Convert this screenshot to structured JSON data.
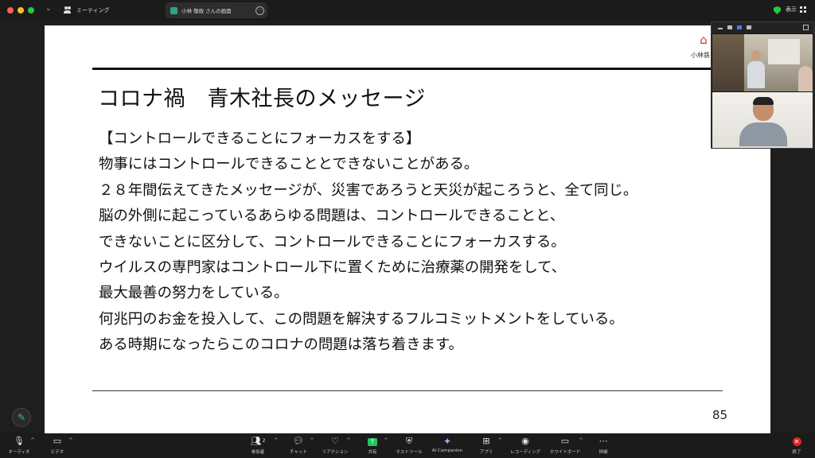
{
  "window": {
    "meeting_tab_label": "ミーティング",
    "screen_tab_label": "小林 敬政 さんの画面",
    "view_label": "表示"
  },
  "slide": {
    "logo_text": "小林鉄",
    "title": "コロナ禍　青木社長のメッセージ",
    "lines": [
      "【コントロールできることにフォーカスをする】",
      "物事にはコントロールできることとできないことがある。",
      "２８年間伝えてきたメッセージが、災害であろうと天災が起ころうと、全て同じ。",
      "脳の外側に起こっているあらゆる問題は、コントロールできることと、",
      "できないことに区分して、コントロールできることにフォーカスする。",
      "ウイルスの専門家はコントロール下に置くために治療薬の開発をして、",
      "最大最善の努力をしている。",
      "何兆円のお金を投入して、この問題を解決するフルコミットメントをしている。",
      "ある時期になったらこのコロナの問題は落ち着きます。"
    ],
    "page_number": "85"
  },
  "toolbar": {
    "audio": "オーディオ",
    "video": "ビデオ",
    "participants": "参加者",
    "participants_count": "2",
    "chat": "チャット",
    "reactions": "リアクション",
    "share": "共有",
    "host_tools": "ホストツール",
    "ai_companion": "AI Companion",
    "apps": "アプリ",
    "recording": "レコーディング",
    "whiteboard": "ホワイトボード",
    "more": "詳細",
    "end": "終了"
  },
  "colors": {
    "share_accent": "#22c55e",
    "end_accent": "#e02424",
    "logo_red": "#c0392b"
  }
}
